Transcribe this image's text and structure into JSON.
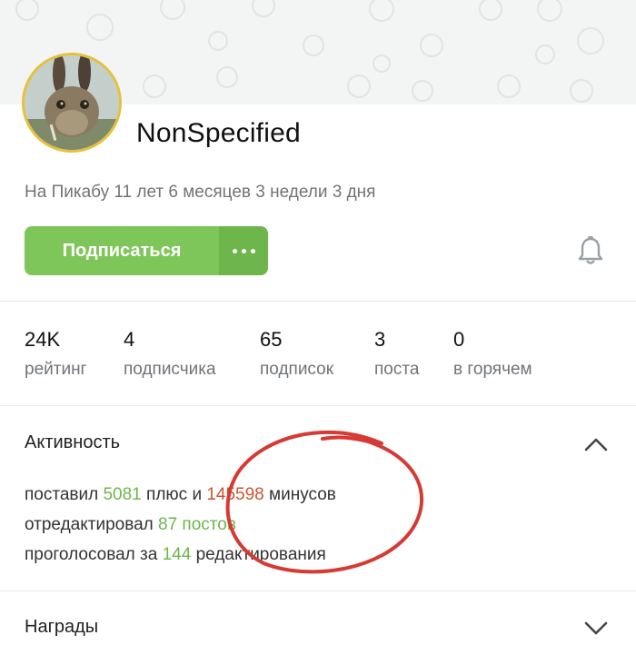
{
  "profile": {
    "username": "NonSpecified",
    "since": "На Пикабу 11 лет 6 месяцев 3 недели 3 дня"
  },
  "actions": {
    "subscribe_label": "Подписаться"
  },
  "stats": [
    {
      "value": "24K",
      "label": "рейтинг"
    },
    {
      "value": "4",
      "label": "подписчика"
    },
    {
      "value": "65",
      "label": "подписок"
    },
    {
      "value": "3",
      "label": "поста"
    },
    {
      "value": "0",
      "label": "в горячем"
    }
  ],
  "activity": {
    "title": "Активность",
    "line1": {
      "pre": "поставил ",
      "plus_count": "5081",
      "mid": " плюс и ",
      "minus_count": "145598",
      "post": " минусов"
    },
    "line2": {
      "pre": "отредактировал ",
      "count": "87",
      "post": " постов"
    },
    "line3": {
      "pre": "проголосовал за ",
      "count": "144",
      "post": " редактирования"
    }
  },
  "awards": {
    "title": "Награды"
  },
  "colors": {
    "accent_green": "#7fc65a",
    "minus_red": "#c9562e",
    "annotation_red": "#d63a34",
    "avatar_border": "#e6c13a"
  }
}
